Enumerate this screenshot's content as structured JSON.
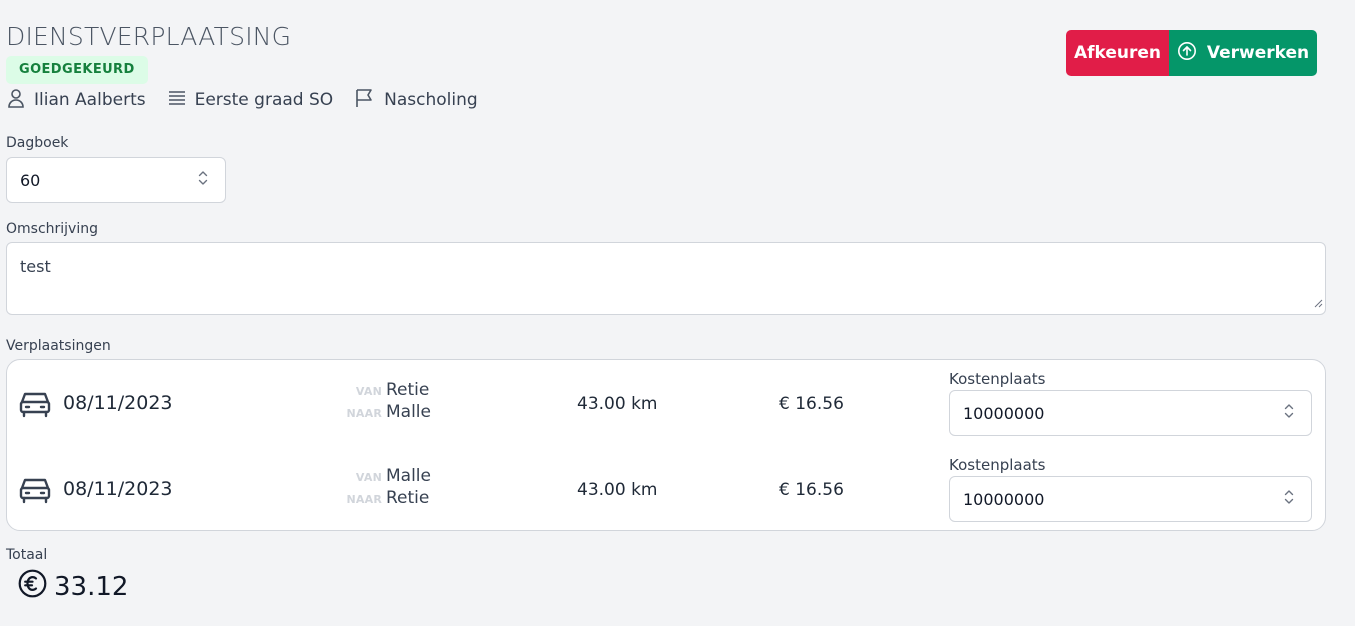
{
  "header": {
    "title": "DIENSTVERPLAATSING",
    "status_badge": "GOEDGEKEURD",
    "meta": {
      "person": "Ilian Aalberts",
      "group": "Eerste graad SO",
      "category": "Nascholing"
    }
  },
  "actions": {
    "reject_label": "Afkeuren",
    "process_label": "Verwerken"
  },
  "form": {
    "dagboek_label": "Dagboek",
    "dagboek_value": "60",
    "omschrijving_label": "Omschrijving",
    "omschrijving_value": "test",
    "verplaatsingen_label": "Verplaatsingen"
  },
  "trips": [
    {
      "date": "08/11/2023",
      "from_tag": "VAN",
      "from": "Retie",
      "to_tag": "NAAR",
      "to": "Malle",
      "distance": "43.00 km",
      "cost": "€ 16.56",
      "kostenplaats_label": "Kostenplaats",
      "kostenplaats_value": "10000000"
    },
    {
      "date": "08/11/2023",
      "from_tag": "VAN",
      "from": "Malle",
      "to_tag": "NAAR",
      "to": "Retie",
      "distance": "43.00 km",
      "cost": "€ 16.56",
      "kostenplaats_label": "Kostenplaats",
      "kostenplaats_value": "10000000"
    }
  ],
  "totals": {
    "label": "Totaal",
    "value": "33.12"
  },
  "icons": {
    "person": "user-icon",
    "group": "list-icon",
    "category": "flag-icon",
    "process": "arrow-up-circle-icon",
    "trip": "car-icon",
    "currency": "euro-circle-icon",
    "select": "chevron-up-down-icon"
  },
  "colors": {
    "reject": "#e11d48",
    "process": "#059669",
    "badge_bg": "#dcfce7",
    "badge_text": "#15803d"
  }
}
